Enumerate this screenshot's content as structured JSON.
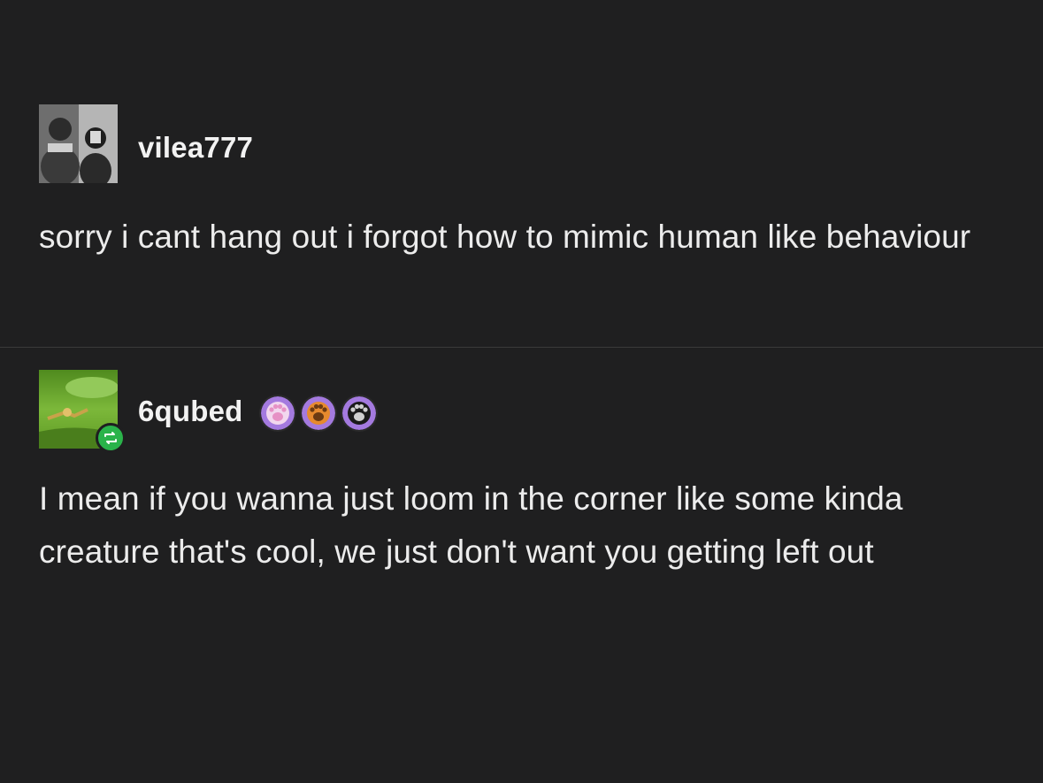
{
  "posts": [
    {
      "username": "vilea777",
      "text": "sorry i cant hang out i forgot how to mimic human like behaviour",
      "avatar_icon": "user-photo-avatar"
    },
    {
      "username": "6qubed",
      "text": "I mean if you wanna just loom in the corner like some kinda creature that's cool, we just don't want you getting left out",
      "avatar_icon": "nature-photo-avatar",
      "reblog_icon": "reblog-icon",
      "badges": [
        "paw-badge-pink",
        "paw-badge-orange",
        "paw-badge-black"
      ]
    }
  ],
  "colors": {
    "background": "#1f1f20",
    "text": "#ececec",
    "reblog_green": "#2ab34a",
    "divider": "#3a3a3a"
  }
}
